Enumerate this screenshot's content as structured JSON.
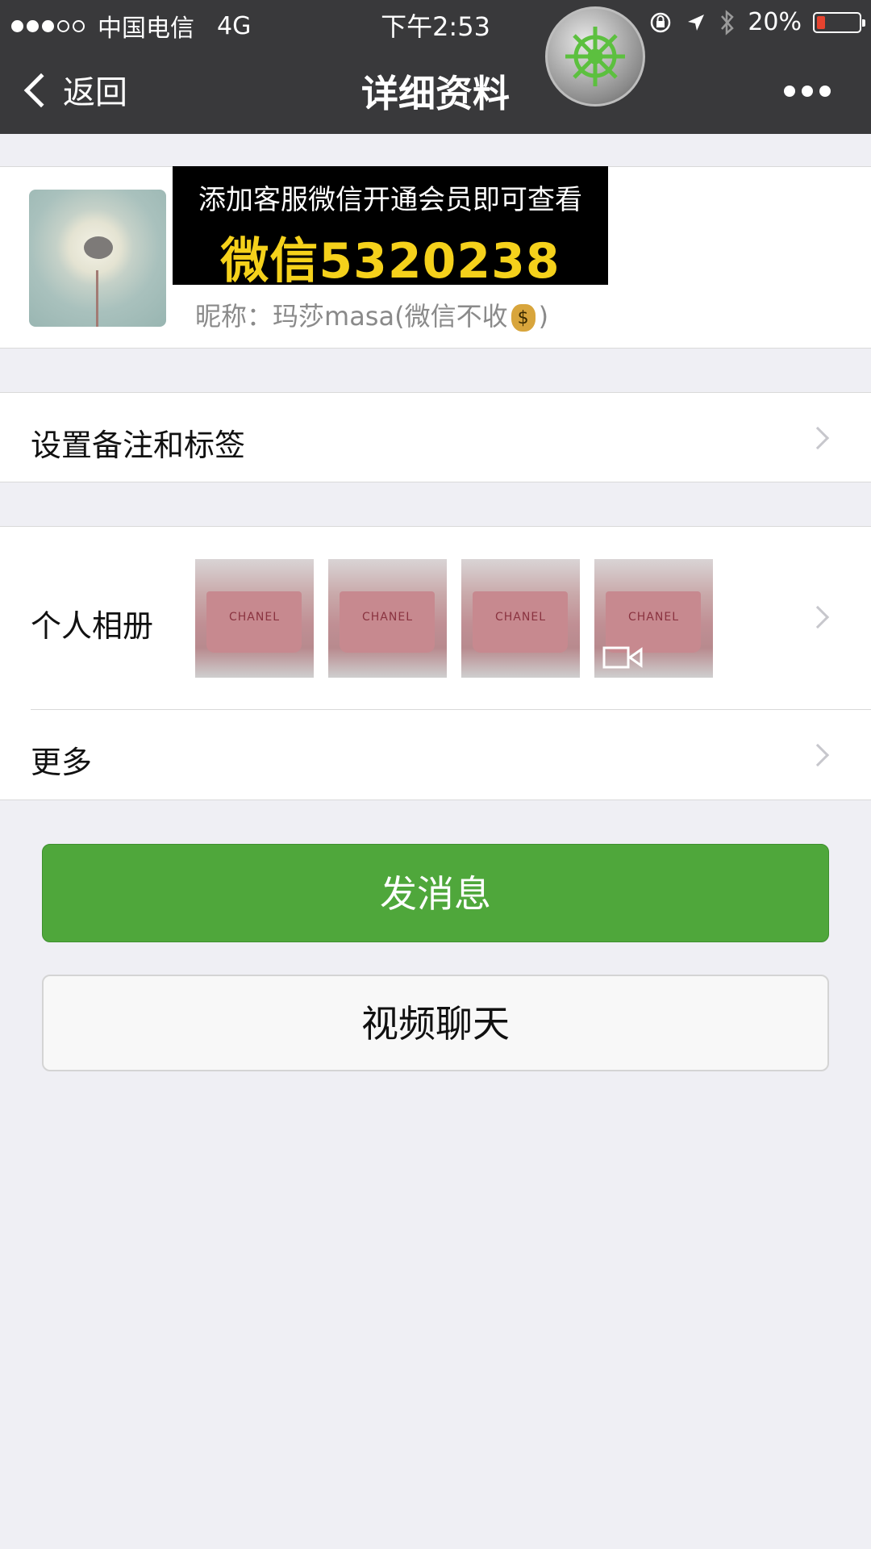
{
  "status_bar": {
    "carrier": "中国电信",
    "network": "4G",
    "time": "下午2:53",
    "battery": "20%",
    "battery_level": 0.2,
    "signal_strength": 3,
    "signal_max": 5
  },
  "nav": {
    "back_label": "返回",
    "title": "详细资料"
  },
  "overlay_badge": {
    "icon": "ship-wheel-icon",
    "accent": "#5cc03f"
  },
  "ad_banner": {
    "line1": "添加客服微信开通会员即可查看",
    "line2": "微信5320238"
  },
  "profile": {
    "nickname_label": "昵称：",
    "nickname": "玛莎masa(微信不收",
    "nickname_suffix": ")",
    "emoji": "money-bag"
  },
  "rows": {
    "remark": "设置备注和标签",
    "album": "个人相册",
    "more": "更多"
  },
  "album_thumbnails": [
    {
      "brand": "CHANEL",
      "video": false
    },
    {
      "brand": "CHANEL",
      "video": false
    },
    {
      "brand": "CHANEL",
      "video": false
    },
    {
      "brand": "CHANEL",
      "video": true
    }
  ],
  "buttons": {
    "message": "发消息",
    "video_chat": "视频聊天"
  },
  "colors": {
    "nav_bg": "#39393b",
    "primary_green": "#4fa73b",
    "ad_yellow": "#f5d11b",
    "battery_low": "#e5432f"
  }
}
